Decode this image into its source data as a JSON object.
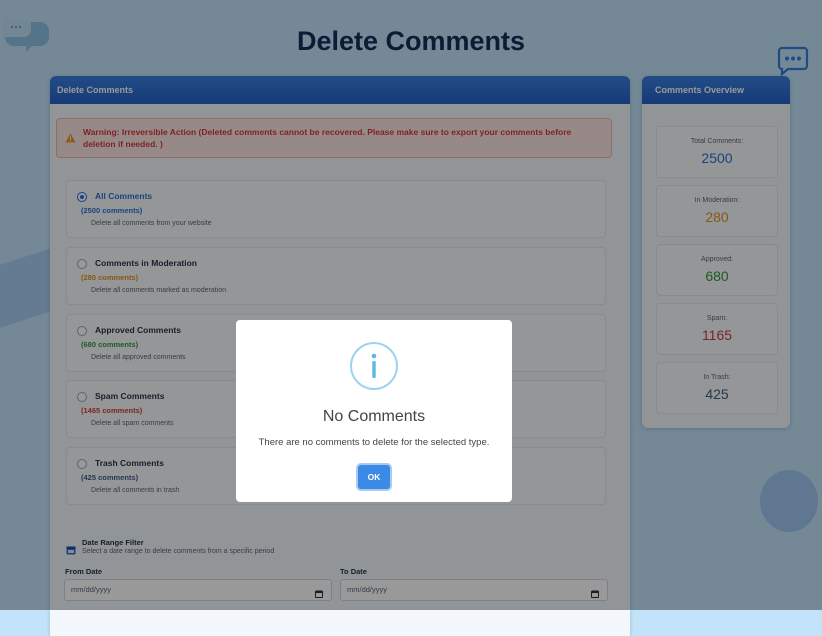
{
  "page": {
    "title": "Delete Comments"
  },
  "main_panel": {
    "header": "Delete Comments",
    "warning": "Warning: Irreversible Action (Deleted comments cannot be recovered. Please make sure to export your comments before deletion if needed. )",
    "options": [
      {
        "title": "All Comments",
        "count": "(2500 comments)",
        "desc": "Delete all comments from your website",
        "selected": true,
        "color": "#2c6fd6"
      },
      {
        "title": "Comments in Moderation",
        "count": "(280 comments)",
        "desc": "Delete all comments marked as moderation",
        "selected": false,
        "color": "#e0921e"
      },
      {
        "title": "Approved Comments",
        "count": "(680 comments)",
        "desc": "Delete all approved comments",
        "selected": false,
        "color": "#2f9a3e"
      },
      {
        "title": "Spam Comments",
        "count": "(1465 comments)",
        "desc": "Delete all spam comments",
        "selected": false,
        "color": "#d23b3b"
      },
      {
        "title": "Trash Comments",
        "count": "(425 comments)",
        "desc": "Delete all comments in trash",
        "selected": false,
        "color": "#3f5f86"
      }
    ],
    "date_filter": {
      "title": "Date Range Filter",
      "subtitle": "Select a date range to delete comments from a specific period",
      "from_label": "From Date",
      "from_placeholder": "mm/dd/yyyy",
      "to_label": "To Date",
      "to_placeholder": "mm/dd/yyyy"
    }
  },
  "overview": {
    "header": "Comments Overview",
    "stats": [
      {
        "label": "Total Comments:",
        "value": "2500",
        "color": "#2c6fd6"
      },
      {
        "label": "In Moderation:",
        "value": "280",
        "color": "#e0921e"
      },
      {
        "label": "Approved:",
        "value": "680",
        "color": "#2f9a3e"
      },
      {
        "label": "Spam:",
        "value": "1165",
        "color": "#d23b3b"
      },
      {
        "label": "In Trash:",
        "value": "425",
        "color": "#3f5f86"
      }
    ]
  },
  "modal": {
    "icon": "info-icon",
    "title": "No Comments",
    "text": "There are no comments to delete for the selected type.",
    "ok_label": "OK"
  }
}
